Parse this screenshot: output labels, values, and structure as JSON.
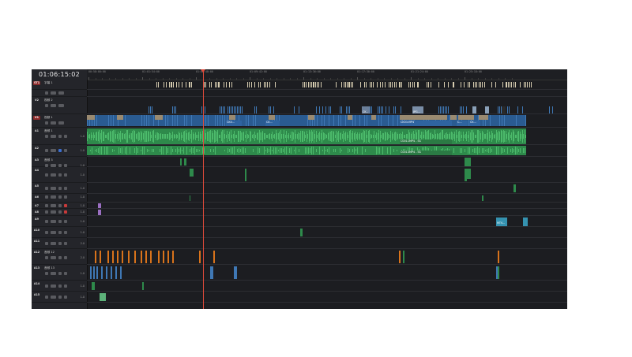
{
  "timecode": "01:06:15:02",
  "ruler": {
    "ticks": [
      "00:58:00:00",
      "01:01:54:00",
      "01:05:48:00",
      "01:09:42:00",
      "01:13:36:00",
      "01:17:30:00",
      "01:21:24:00",
      "01:25:18:00"
    ],
    "playhead_time": "01:06:15:02"
  },
  "tracks": [
    {
      "id": "ST1",
      "name": "字幕 1",
      "kind": "subtitle",
      "h": 13,
      "badge_highlight": true
    },
    {
      "id": "",
      "name": "",
      "kind": "spacer",
      "h": 9
    },
    {
      "id": "V2",
      "name": "视频 2",
      "kind": "video",
      "h": 22
    },
    {
      "id": "V1",
      "name": "视频 1",
      "kind": "video",
      "h": 17,
      "badge_highlight": true
    },
    {
      "id": "A1",
      "name": "音频 1",
      "kind": "audio",
      "h": 22,
      "channels": "1.0"
    },
    {
      "id": "A2",
      "name": "",
      "kind": "audio",
      "h": 15,
      "channels": "1.0",
      "blue": true
    },
    {
      "id": "A3",
      "name": "音频 3",
      "kind": "audio",
      "h": 13,
      "channels": "1.0"
    },
    {
      "id": "A4",
      "name": "",
      "kind": "audio",
      "h": 20,
      "channels": "1.0"
    },
    {
      "id": "A5",
      "name": "",
      "kind": "audio",
      "h": 14,
      "channels": "1.0"
    },
    {
      "id": "A6",
      "name": "",
      "kind": "audio",
      "h": 11,
      "channels": "1.0"
    },
    {
      "id": "A7",
      "name": "",
      "kind": "audio",
      "h": 8,
      "channels": "1.0",
      "red": true
    },
    {
      "id": "A8",
      "name": "",
      "kind": "audio",
      "h": 9,
      "channels": "1.0",
      "red": true
    },
    {
      "id": "A9",
      "name": "",
      "kind": "audio",
      "h": 14,
      "channels": "1.0"
    },
    {
      "id": "A10",
      "name": "",
      "kind": "audio",
      "h": 14,
      "channels": "1.0"
    },
    {
      "id": "A11",
      "name": "",
      "kind": "audio",
      "h": 14,
      "channels": "2.0"
    },
    {
      "id": "A12",
      "name": "音频 12",
      "kind": "audio",
      "h": 20,
      "channels": "2.0"
    },
    {
      "id": "A13",
      "name": "音频 13",
      "kind": "audio",
      "h": 20,
      "channels": "1.0"
    },
    {
      "id": "A14",
      "name": "",
      "kind": "audio",
      "h": 14,
      "channels": "1.0"
    },
    {
      "id": "A15",
      "name": "",
      "kind": "audio",
      "h": 14,
      "channels": "1.0"
    }
  ],
  "clip_labels": {
    "v1_a": "CK0...",
    "v1_b": "CK...",
    "v1_main": "CK03.MP4",
    "v1_c": "C...",
    "v1_d": "CK...",
    "a1_main": "C0011MP4 - SS",
    "a2_main": "C0013MP4 - SS",
    "a4_clip": "MTV...",
    "v2_a": "CK..",
    "v2_b": "JPG..."
  },
  "colors": {
    "subtitle": "#d6ccb0",
    "video": "#3f78b5",
    "video_dark": "#2a5b91",
    "audio": "#2e8a4b",
    "audio_light": "#4cba6b",
    "orange": "#d9731b",
    "purple": "#9b6fc2",
    "teal": "#3aa0b8",
    "playhead": "#e04a3a"
  }
}
